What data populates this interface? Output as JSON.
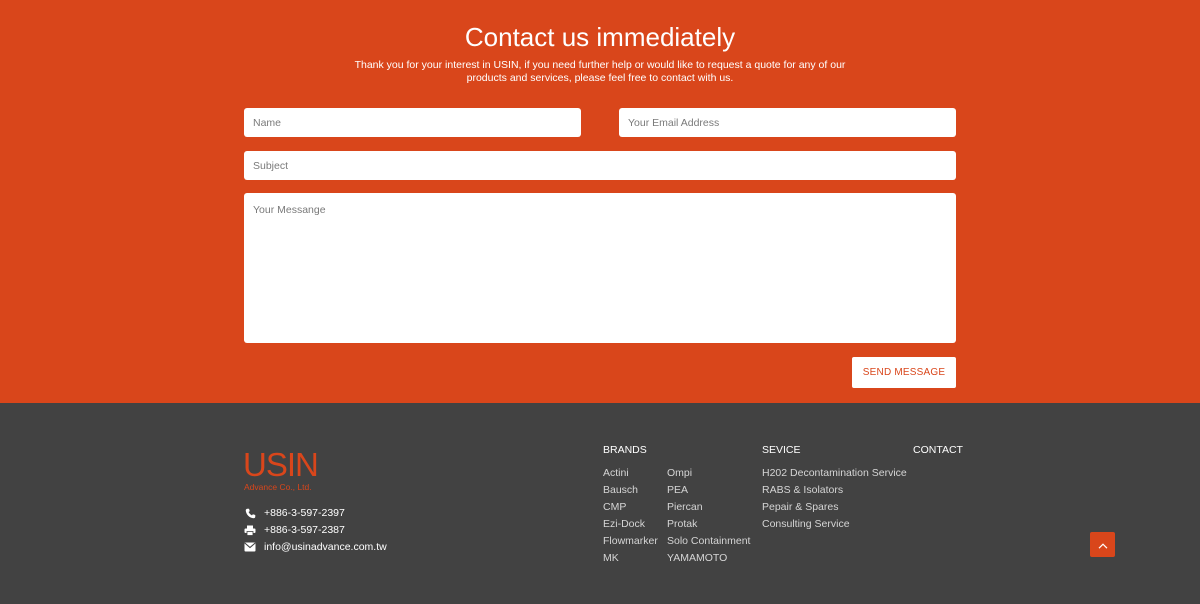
{
  "contact": {
    "title": "Contact us immediately",
    "description": "Thank you for your interest in USIN, if you need further help or would like to request a quote for any of our products and services, please feel free to contact with us.",
    "form": {
      "name_placeholder": "Name",
      "email_placeholder": "Your Email Address",
      "subject_placeholder": "Subject",
      "message_placeholder": "Your Messange",
      "send_label": "SEND MESSAGE"
    }
  },
  "footer": {
    "logo": {
      "name": "USIN",
      "subtitle": "Advance Co., Ltd."
    },
    "phone": "+886-3-597-2397",
    "fax": "+886-3-597-2387",
    "email": "info@usinadvance.com.tw",
    "brands": {
      "heading": "BRANDS",
      "column1": [
        "Actini",
        "Bausch",
        "CMP",
        "Ezi-Dock",
        "Flowmarker",
        "MK"
      ],
      "column2": [
        "Ompi",
        "PEA",
        "Piercan",
        "Protak",
        "Solo Containment",
        "YAMAMOTO"
      ]
    },
    "service": {
      "heading": "SEVICE",
      "items": [
        "H202 Decontamination Service",
        "RABS & Isolators",
        "Pepair & Spares",
        "Consulting Service"
      ]
    },
    "contact_heading": "CONTACT"
  },
  "icons": {
    "phone": "phone-icon",
    "fax": "printer-icon",
    "email": "envelope-icon",
    "back_to_top": "chevron-up-icon"
  },
  "colors": {
    "accent": "#d9461b",
    "footer_bg": "#424242",
    "white": "#ffffff"
  }
}
